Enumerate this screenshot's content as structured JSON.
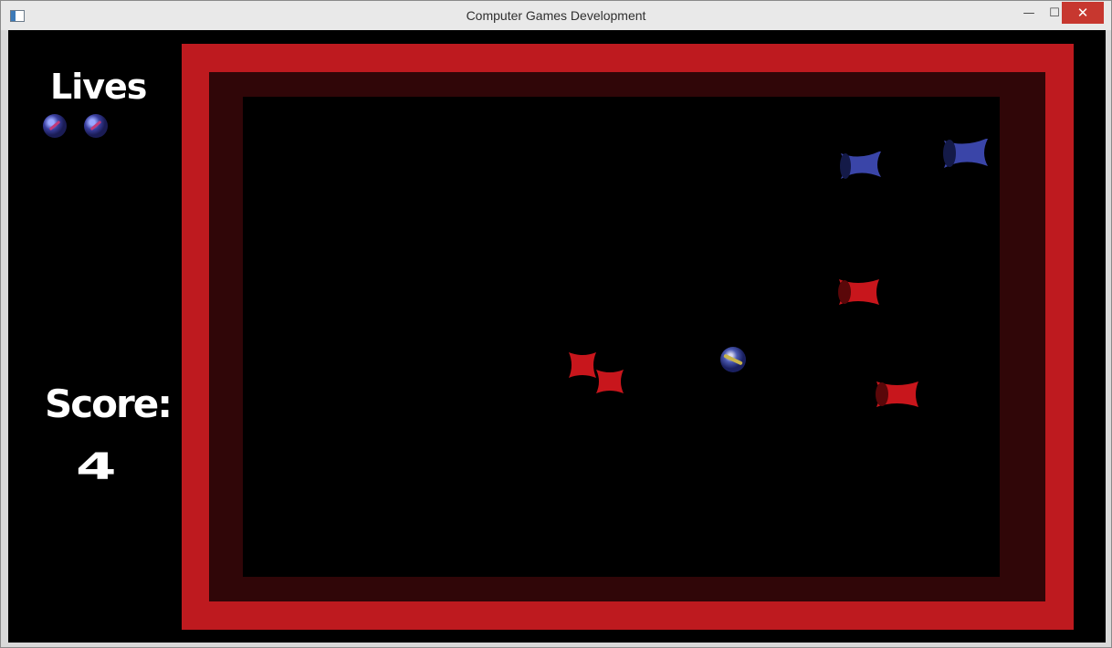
{
  "window": {
    "title": "Computer Games Development",
    "minimize_glyph": "—",
    "maximize_glyph": "☐",
    "close_glyph": "✕"
  },
  "hud": {
    "lives_label": "Lives",
    "lives_count": 2,
    "score_label": "Score:",
    "score_value": "4"
  },
  "colors": {
    "arena_outer_wall": "#be1a1f",
    "arena_inner_wall": "#300608",
    "floor": "#000000",
    "red_enemy": "#c8161c",
    "blue_enemy": "#3a45a8"
  },
  "entities": {
    "red_enemies": 4,
    "blue_enemies": 2,
    "player_ball": 1
  }
}
